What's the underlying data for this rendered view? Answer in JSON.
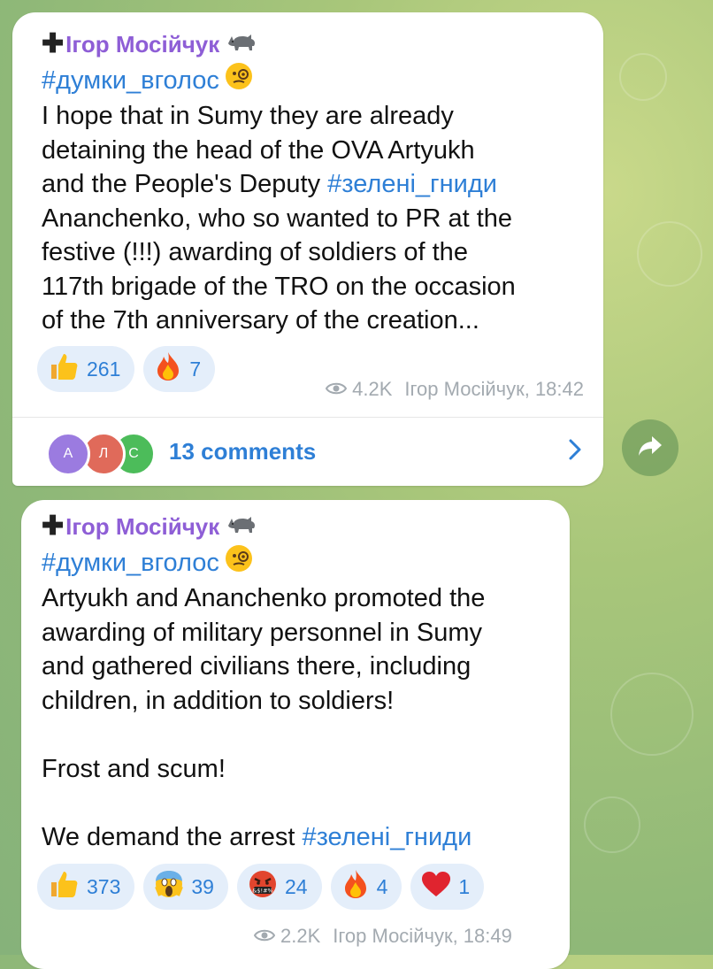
{
  "messages": [
    {
      "sender": "Ігор Мосійчук",
      "tag": "#думки_вголос",
      "lines": [
        "I hope that in Sumy they are already",
        "detaining the head of the OVA Artyukh",
        "and the People's Deputy ",
        "Ananchenko, who so wanted to PR at the",
        "festive (!!!) awarding of soldiers of the",
        "117th brigade of the TRO on the occasion",
        "of the 7th anniversary of the creation..."
      ],
      "inline_tag": "#зелені_гниди",
      "reactions": [
        {
          "icon": "thumbs-up",
          "count": "261"
        },
        {
          "icon": "fire",
          "count": "7"
        }
      ],
      "views": "4.2K",
      "author_time": "Ігор Мосійчук, 18:42",
      "comments": {
        "avatars": [
          "А",
          "Л",
          "С"
        ],
        "label": "13 comments"
      }
    },
    {
      "sender": "Ігор Мосійчук",
      "tag": "#думки_вголос",
      "lines": [
        "Artyukh and Ananchenko promoted the",
        "awarding of military personnel in Sumy",
        "and gathered civilians there, including",
        "children, in addition to soldiers!",
        "",
        "Frost and scum!",
        "",
        "We demand the arrest "
      ],
      "inline_tag": "#зелені_гниди",
      "reactions": [
        {
          "icon": "thumbs-up",
          "count": "373"
        },
        {
          "icon": "screaming-face",
          "count": "39"
        },
        {
          "icon": "cursing-face",
          "count": "24"
        },
        {
          "icon": "fire",
          "count": "4"
        },
        {
          "icon": "red-heart",
          "count": "1"
        }
      ],
      "views": "2.2K",
      "author_time": "Ігор Мосійчук, 18:49"
    }
  ],
  "colors": {
    "sender": "#8e5ed6",
    "link": "#2e7fd6",
    "chip_bg": "#e4eefa",
    "meta": "#a3aab0"
  }
}
